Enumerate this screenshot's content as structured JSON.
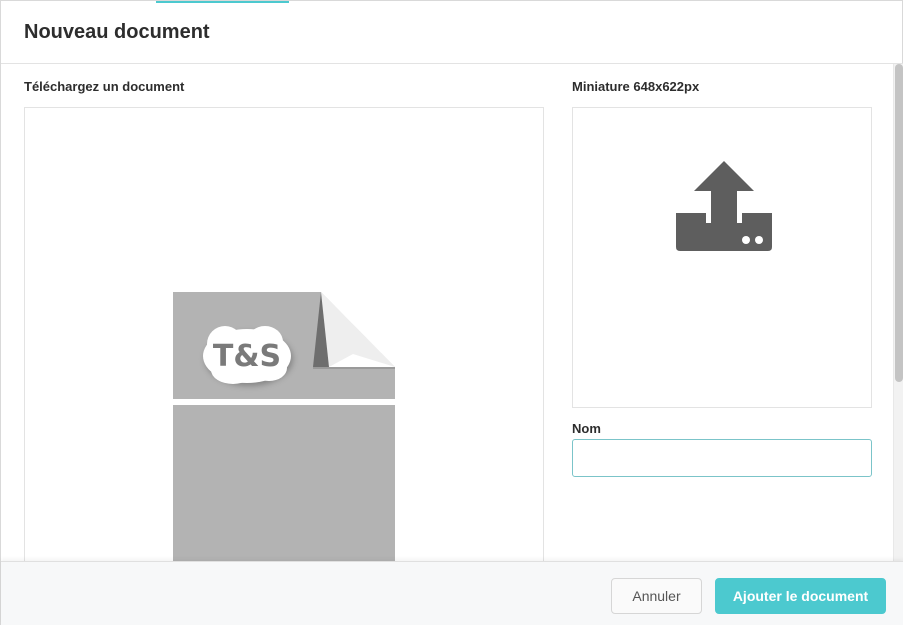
{
  "modal": {
    "title": "Nouveau document"
  },
  "upload": {
    "label": "Téléchargez un document",
    "placeholder_logo_text": "T&S"
  },
  "thumbnail": {
    "label": "Miniature 648x622px",
    "icon": "upload-icon"
  },
  "name_field": {
    "label": "Nom",
    "value": "",
    "placeholder": ""
  },
  "footer": {
    "cancel_label": "Annuler",
    "add_label": "Ajouter le document"
  },
  "colors": {
    "accent": "#4cc9cf",
    "placeholder_gray": "#b3b3b3",
    "icon_gray": "#5e5e5e"
  }
}
